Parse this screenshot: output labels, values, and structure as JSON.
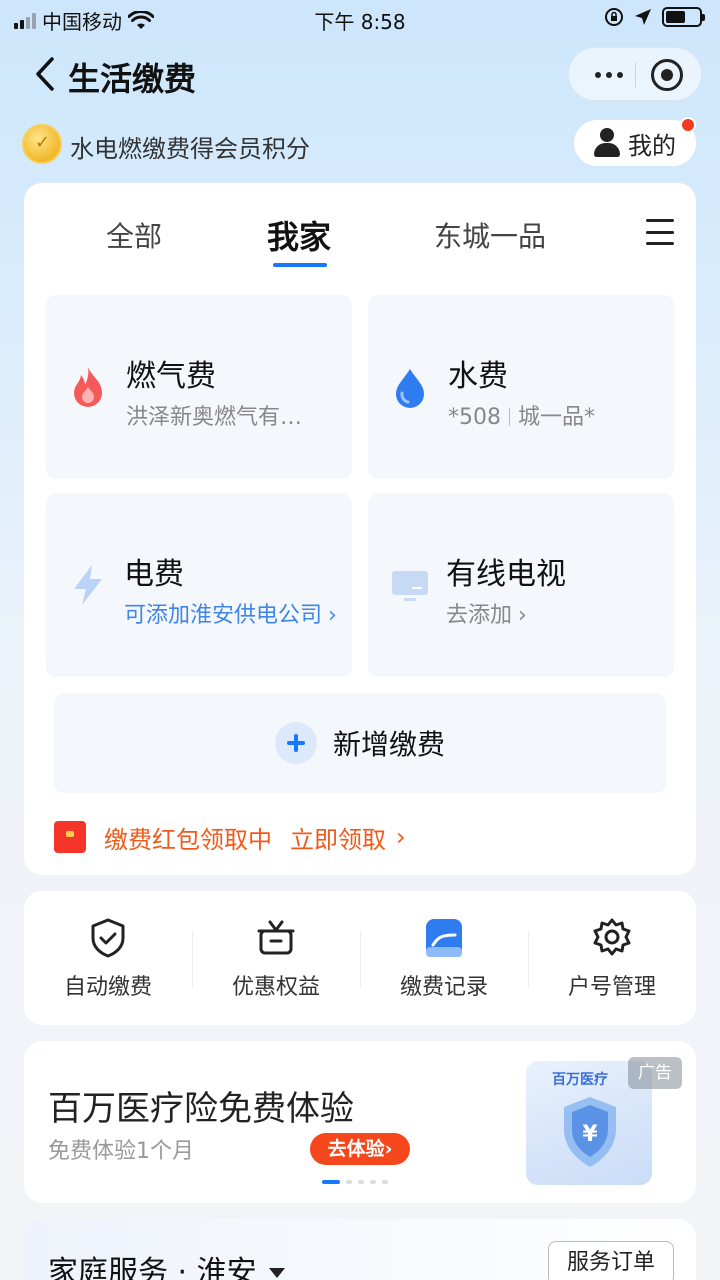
{
  "status_bar": {
    "carrier": "中国移动",
    "time": "下午 8:58"
  },
  "nav": {
    "title": "生活缴费"
  },
  "member": {
    "text": "水电燃缴费得会员积分",
    "mine_label": "我的"
  },
  "tabs": [
    {
      "label": "全部"
    },
    {
      "label": "我家"
    },
    {
      "label": "东城一品"
    }
  ],
  "tiles": {
    "gas": {
      "name": "燃气费",
      "sub": "洪泽新奥燃气有…"
    },
    "water": {
      "name": "水费",
      "sub_a": "*508",
      "sub_b": "城一品*"
    },
    "electric": {
      "name": "电费",
      "sub": "可添加淮安供电公司"
    },
    "tv": {
      "name": "有线电视",
      "sub": "去添加"
    }
  },
  "add": {
    "label": "新增缴费"
  },
  "promo": {
    "text": "缴费红包领取中",
    "action": "立即领取"
  },
  "shortcuts": [
    {
      "label": "自动缴费",
      "icon": "shield-check-icon"
    },
    {
      "label": "优惠权益",
      "icon": "gift-icon"
    },
    {
      "label": "缴费记录",
      "icon": "record-icon"
    },
    {
      "label": "户号管理",
      "icon": "gear-icon"
    }
  ],
  "ad": {
    "title": "百万医疗险免费体验",
    "sub": "免费体验1个月",
    "cta": "去体验",
    "badge": "广告",
    "image_brand": "百万医疗"
  },
  "family": {
    "title": "家庭服务 · 淮安",
    "orders": "服务订单"
  },
  "colors": {
    "accent": "#1677ff",
    "promo": "#f05a1a",
    "cta": "#f5471b"
  }
}
